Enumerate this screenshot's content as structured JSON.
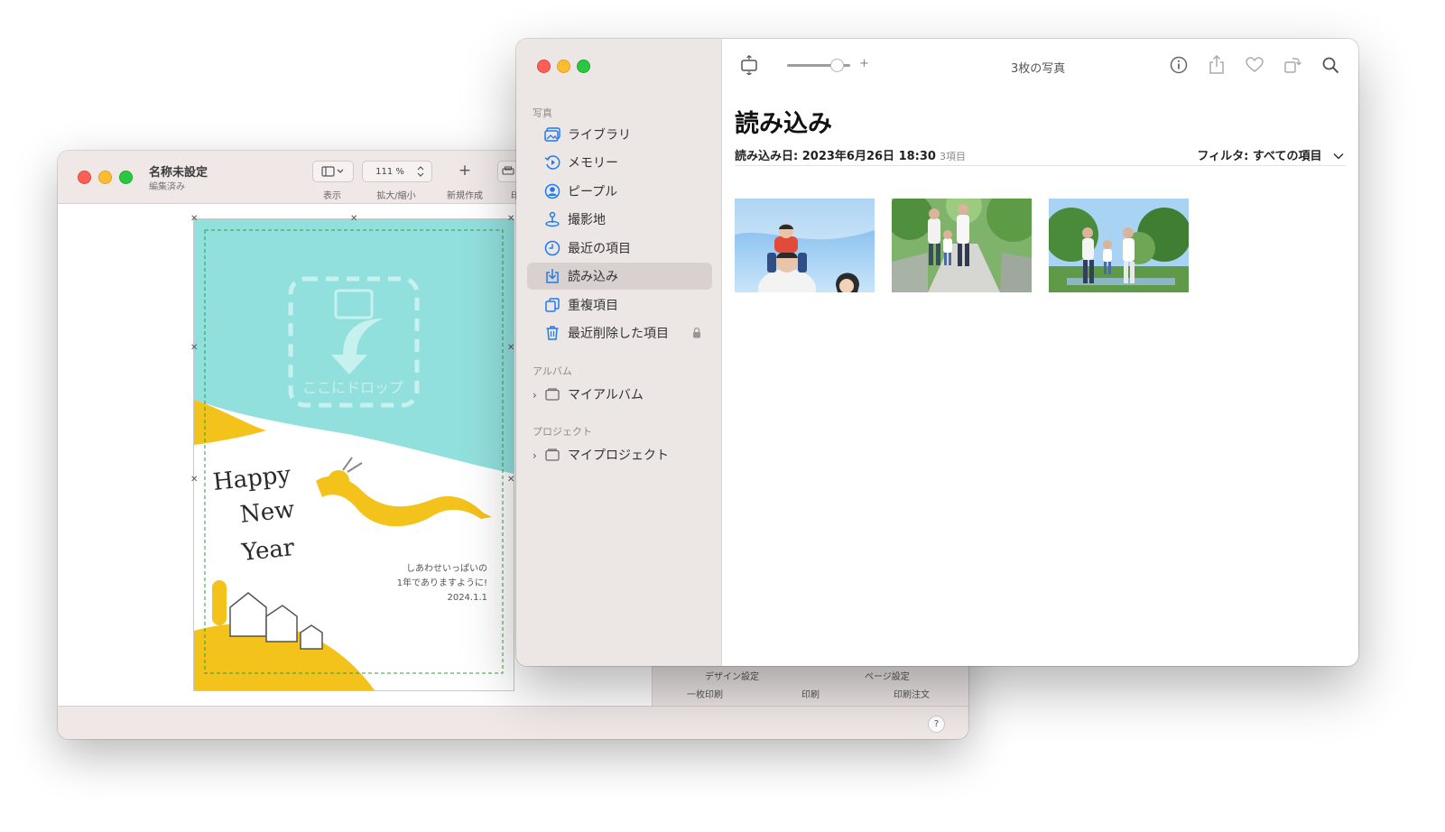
{
  "editor": {
    "title": "名称未設定",
    "subtitle": "編集済み",
    "toolbar": {
      "view_label": "表示",
      "zoom_value": "111 %",
      "zoom_label": "拡大/縮小",
      "new_label": "新規作成",
      "new_symbol": "+",
      "print_label_partial": "印"
    },
    "card": {
      "drop_text": "ここにドロップ",
      "greeting_line1": "Happy",
      "greeting_line2": "New",
      "greeting_line3": "Year",
      "message_line1": "しあわせいっぱいの",
      "message_line2": "1年でありますように!",
      "message_line3": "2024.1.1"
    },
    "panel": {
      "design_settings": "デザイン設定",
      "page_settings": "ページ設定",
      "print_single": "一枚印刷",
      "print": "印刷",
      "print_order": "印刷注文"
    },
    "help_label": "?"
  },
  "photos": {
    "toolbar": {
      "photo_count_title": "3枚の写真",
      "zoom_plus": "+"
    },
    "sidebar": {
      "section_photos": "写真",
      "items": [
        {
          "label": "ライブラリ",
          "icon": "library-icon"
        },
        {
          "label": "メモリー",
          "icon": "memories-icon"
        },
        {
          "label": "ピープル",
          "icon": "people-icon"
        },
        {
          "label": "撮影地",
          "icon": "places-icon"
        },
        {
          "label": "最近の項目",
          "icon": "recents-icon"
        },
        {
          "label": "読み込み",
          "icon": "imports-icon"
        },
        {
          "label": "重複項目",
          "icon": "duplicates-icon"
        },
        {
          "label": "最近削除した項目",
          "icon": "trash-icon"
        }
      ],
      "section_albums": "アルバム",
      "my_albums": "マイアルバム",
      "section_projects": "プロジェクト",
      "my_projects": "マイプロジェクト"
    },
    "main": {
      "heading": "読み込み",
      "import_date": "読み込み日: 2023年6月26日 18:30",
      "item_count": "3項目",
      "filter": "フィルタ: すべての項目"
    }
  },
  "colors": {
    "card_teal": "#92e0de",
    "card_yellow": "#f3c21b",
    "selected_row": "#d8d1d0",
    "accent_blue": "#1f7bf2"
  }
}
